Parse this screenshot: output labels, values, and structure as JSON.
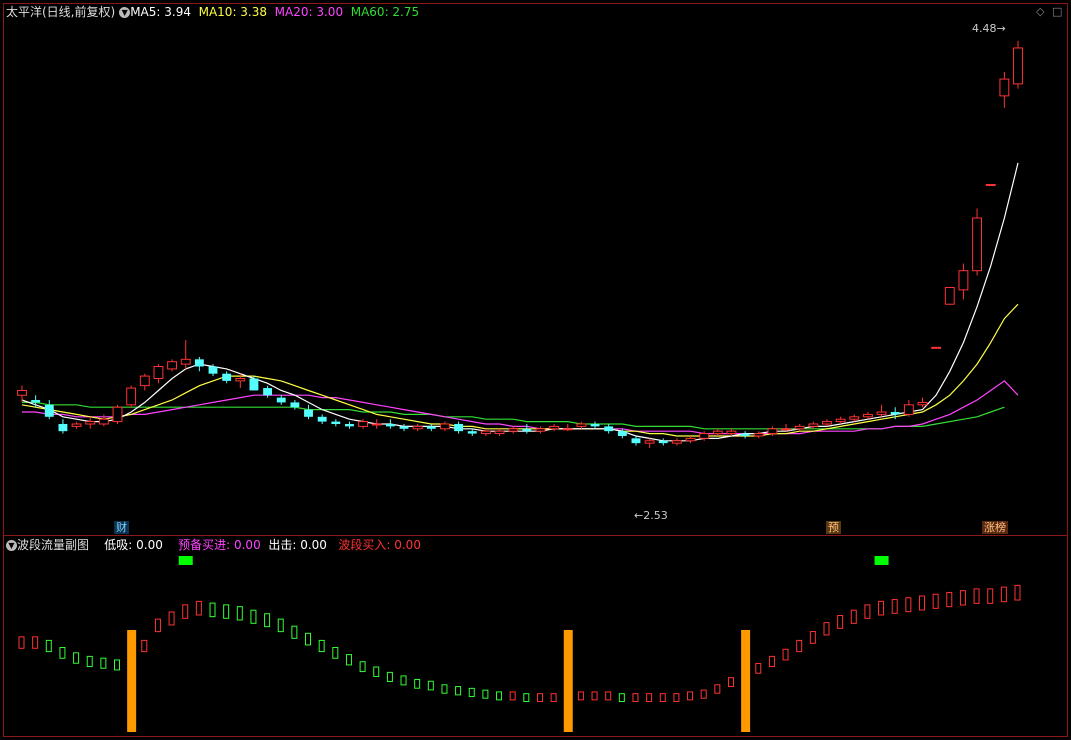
{
  "main_panel": {
    "title": "太平洋(日线,前复权)",
    "ma5_label": "MA5: 3.94",
    "ma10_label": "MA10: 3.38",
    "ma20_label": "MA20: 3.00",
    "ma60_label": "MA60: 2.75",
    "high_annotation": "4.48",
    "low_annotation": "2.53",
    "event_tags": [
      "财",
      "预",
      "涨榜"
    ],
    "colors": {
      "ma5": "#ffffff",
      "ma10": "#ffff44",
      "ma20": "#ff44ff",
      "ma60": "#33dd33",
      "up": "#ff3333",
      "down": "#55ffff"
    }
  },
  "sub_panel": {
    "title": "波段流量副图",
    "low_buy_label": "低吸: 0.00",
    "ready_buy_label": "预备买进: 0.00",
    "exit_label": "出击: 0.00",
    "wave_buy_label": "波段买入: 0.00",
    "colors": {
      "low_buy": "#ffffff",
      "ready_buy": "#ff44ff",
      "exit": "#ffffff",
      "wave_buy": "#ff3333",
      "bar": "#ff9900",
      "signal": "#00ff00"
    }
  },
  "icons": [
    "settings-circle-icon",
    "diamond-icon",
    "square-icon"
  ],
  "chart_data": {
    "type": "candlestick",
    "title": "太平洋(日线,前复权)",
    "ohlc": [
      [
        3.0,
        3.04,
        2.97,
        3.02
      ],
      [
        2.98,
        3.0,
        2.95,
        2.97
      ],
      [
        2.96,
        2.98,
        2.9,
        2.91
      ],
      [
        2.88,
        2.9,
        2.84,
        2.85
      ],
      [
        2.87,
        2.89,
        2.86,
        2.88
      ],
      [
        2.88,
        2.91,
        2.86,
        2.89
      ],
      [
        2.88,
        2.92,
        2.87,
        2.9
      ],
      [
        2.89,
        2.96,
        2.88,
        2.95
      ],
      [
        2.96,
        3.04,
        2.95,
        3.03
      ],
      [
        3.04,
        3.09,
        3.02,
        3.08
      ],
      [
        3.07,
        3.13,
        3.05,
        3.12
      ],
      [
        3.11,
        3.15,
        3.1,
        3.14
      ],
      [
        3.13,
        3.23,
        3.11,
        3.15
      ],
      [
        3.15,
        3.16,
        3.1,
        3.12
      ],
      [
        3.12,
        3.13,
        3.08,
        3.09
      ],
      [
        3.09,
        3.1,
        3.05,
        3.06
      ],
      [
        3.06,
        3.09,
        3.03,
        3.07
      ],
      [
        3.07,
        3.08,
        3.02,
        3.02
      ],
      [
        3.03,
        3.04,
        2.99,
        3.0
      ],
      [
        2.99,
        3.0,
        2.96,
        2.97
      ],
      [
        2.97,
        2.98,
        2.94,
        2.95
      ],
      [
        2.94,
        2.96,
        2.9,
        2.91
      ],
      [
        2.91,
        2.92,
        2.88,
        2.89
      ],
      [
        2.89,
        2.9,
        2.87,
        2.88
      ],
      [
        2.88,
        2.89,
        2.86,
        2.87
      ],
      [
        2.87,
        2.9,
        2.86,
        2.89
      ],
      [
        2.88,
        2.9,
        2.86,
        2.88
      ],
      [
        2.88,
        2.9,
        2.86,
        2.87
      ],
      [
        2.87,
        2.88,
        2.85,
        2.86
      ],
      [
        2.86,
        2.88,
        2.85,
        2.87
      ],
      [
        2.87,
        2.88,
        2.85,
        2.86
      ],
      [
        2.86,
        2.89,
        2.85,
        2.88
      ],
      [
        2.88,
        2.89,
        2.84,
        2.85
      ],
      [
        2.85,
        2.86,
        2.83,
        2.84
      ],
      [
        2.84,
        2.86,
        2.83,
        2.85
      ],
      [
        2.84,
        2.86,
        2.83,
        2.85
      ],
      [
        2.85,
        2.87,
        2.84,
        2.86
      ],
      [
        2.86,
        2.88,
        2.84,
        2.85
      ],
      [
        2.85,
        2.87,
        2.84,
        2.86
      ],
      [
        2.86,
        2.88,
        2.85,
        2.87
      ],
      [
        2.86,
        2.88,
        2.85,
        2.86
      ],
      [
        2.87,
        2.89,
        2.86,
        2.88
      ],
      [
        2.88,
        2.89,
        2.86,
        2.87
      ],
      [
        2.87,
        2.88,
        2.84,
        2.85
      ],
      [
        2.85,
        2.86,
        2.82,
        2.83
      ],
      [
        2.82,
        2.83,
        2.79,
        2.8
      ],
      [
        2.8,
        2.82,
        2.78,
        2.81
      ],
      [
        2.81,
        2.82,
        2.79,
        2.8
      ],
      [
        2.8,
        2.82,
        2.79,
        2.81
      ],
      [
        2.81,
        2.83,
        2.8,
        2.82
      ],
      [
        2.82,
        2.85,
        2.81,
        2.84
      ],
      [
        2.84,
        2.86,
        2.83,
        2.85
      ],
      [
        2.84,
        2.86,
        2.83,
        2.85
      ],
      [
        2.84,
        2.85,
        2.82,
        2.83
      ],
      [
        2.83,
        2.85,
        2.82,
        2.84
      ],
      [
        2.84,
        2.87,
        2.83,
        2.86
      ],
      [
        2.86,
        2.88,
        2.85,
        2.86
      ],
      [
        2.86,
        2.88,
        2.85,
        2.87
      ],
      [
        2.87,
        2.89,
        2.86,
        2.88
      ],
      [
        2.88,
        2.9,
        2.87,
        2.89
      ],
      [
        2.89,
        2.91,
        2.88,
        2.9
      ],
      [
        2.9,
        2.92,
        2.89,
        2.91
      ],
      [
        2.91,
        2.93,
        2.9,
        2.92
      ],
      [
        2.92,
        2.96,
        2.91,
        2.93
      ],
      [
        2.93,
        2.95,
        2.9,
        2.92
      ],
      [
        2.92,
        2.98,
        2.91,
        2.96
      ],
      [
        2.96,
        2.99,
        2.95,
        2.97
      ],
      [
        3.2,
        3.2,
        3.2,
        3.2
      ],
      [
        3.38,
        3.45,
        3.38,
        3.45
      ],
      [
        3.44,
        3.55,
        3.4,
        3.52
      ],
      [
        3.52,
        3.78,
        3.5,
        3.74
      ],
      [
        3.88,
        3.88,
        3.88,
        3.88
      ],
      [
        4.25,
        4.35,
        4.2,
        4.32
      ],
      [
        4.3,
        4.48,
        4.28,
        4.45
      ]
    ],
    "ma5": [
      2.98,
      2.96,
      2.94,
      2.91,
      2.9,
      2.89,
      2.89,
      2.9,
      2.93,
      2.97,
      3.02,
      3.07,
      3.11,
      3.13,
      3.12,
      3.11,
      3.09,
      3.07,
      3.05,
      3.02,
      3.0,
      2.97,
      2.94,
      2.92,
      2.9,
      2.89,
      2.88,
      2.88,
      2.87,
      2.87,
      2.87,
      2.87,
      2.86,
      2.86,
      2.85,
      2.85,
      2.85,
      2.85,
      2.85,
      2.86,
      2.86,
      2.86,
      2.86,
      2.86,
      2.85,
      2.83,
      2.82,
      2.81,
      2.81,
      2.81,
      2.82,
      2.82,
      2.83,
      2.84,
      2.84,
      2.85,
      2.85,
      2.86,
      2.87,
      2.87,
      2.88,
      2.89,
      2.9,
      2.91,
      2.92,
      2.93,
      2.94,
      3.0,
      3.1,
      3.22,
      3.37,
      3.54,
      3.74,
      3.97
    ],
    "ma10": [
      2.96,
      2.95,
      2.94,
      2.93,
      2.92,
      2.91,
      2.9,
      2.91,
      2.92,
      2.94,
      2.96,
      2.98,
      3.01,
      3.04,
      3.06,
      3.08,
      3.08,
      3.08,
      3.07,
      3.06,
      3.04,
      3.02,
      3.0,
      2.98,
      2.96,
      2.94,
      2.92,
      2.91,
      2.9,
      2.89,
      2.88,
      2.88,
      2.87,
      2.87,
      2.86,
      2.86,
      2.86,
      2.86,
      2.86,
      2.86,
      2.86,
      2.86,
      2.86,
      2.86,
      2.85,
      2.85,
      2.84,
      2.84,
      2.83,
      2.83,
      2.83,
      2.83,
      2.83,
      2.83,
      2.83,
      2.84,
      2.84,
      2.85,
      2.85,
      2.86,
      2.87,
      2.88,
      2.89,
      2.9,
      2.91,
      2.92,
      2.93,
      2.96,
      3.0,
      3.06,
      3.13,
      3.22,
      3.32,
      3.38
    ],
    "ma20": [
      2.93,
      2.93,
      2.92,
      2.92,
      2.91,
      2.91,
      2.91,
      2.91,
      2.92,
      2.92,
      2.93,
      2.94,
      2.95,
      2.96,
      2.97,
      2.98,
      2.99,
      3.0,
      3.0,
      3.0,
      3.0,
      3.0,
      2.99,
      2.99,
      2.98,
      2.97,
      2.96,
      2.95,
      2.94,
      2.93,
      2.92,
      2.91,
      2.9,
      2.89,
      2.88,
      2.88,
      2.87,
      2.87,
      2.86,
      2.86,
      2.86,
      2.86,
      2.86,
      2.86,
      2.86,
      2.85,
      2.85,
      2.85,
      2.85,
      2.85,
      2.84,
      2.84,
      2.84,
      2.84,
      2.84,
      2.84,
      2.84,
      2.84,
      2.85,
      2.85,
      2.85,
      2.85,
      2.86,
      2.86,
      2.87,
      2.87,
      2.88,
      2.9,
      2.92,
      2.95,
      2.98,
      3.02,
      3.06,
      3.0
    ],
    "ma60": [
      2.97,
      2.97,
      2.96,
      2.96,
      2.96,
      2.95,
      2.95,
      2.95,
      2.95,
      2.95,
      2.95,
      2.95,
      2.95,
      2.95,
      2.95,
      2.95,
      2.95,
      2.95,
      2.95,
      2.95,
      2.95,
      2.94,
      2.94,
      2.94,
      2.94,
      2.93,
      2.93,
      2.93,
      2.92,
      2.92,
      2.92,
      2.91,
      2.91,
      2.91,
      2.9,
      2.9,
      2.9,
      2.89,
      2.89,
      2.89,
      2.89,
      2.88,
      2.88,
      2.88,
      2.88,
      2.87,
      2.87,
      2.87,
      2.87,
      2.87,
      2.86,
      2.86,
      2.86,
      2.86,
      2.86,
      2.86,
      2.86,
      2.86,
      2.86,
      2.86,
      2.86,
      2.86,
      2.86,
      2.86,
      2.87,
      2.87,
      2.87,
      2.88,
      2.89,
      2.9,
      2.91,
      2.93,
      2.95,
      2.75
    ],
    "indicator": {
      "wave": [
        0.52,
        0.52,
        0.5,
        0.46,
        0.43,
        0.41,
        0.4,
        0.39,
        0.4,
        0.5,
        0.62,
        0.66,
        0.7,
        0.72,
        0.71,
        0.7,
        0.69,
        0.67,
        0.65,
        0.62,
        0.58,
        0.54,
        0.5,
        0.46,
        0.42,
        0.38,
        0.35,
        0.32,
        0.3,
        0.28,
        0.27,
        0.25,
        0.24,
        0.23,
        0.22,
        0.21,
        0.21,
        0.2,
        0.2,
        0.2,
        0.2,
        0.21,
        0.21,
        0.21,
        0.2,
        0.2,
        0.2,
        0.2,
        0.2,
        0.21,
        0.22,
        0.25,
        0.29,
        0.33,
        0.37,
        0.41,
        0.45,
        0.5,
        0.55,
        0.6,
        0.64,
        0.67,
        0.7,
        0.72,
        0.73,
        0.74,
        0.75,
        0.76,
        0.77,
        0.78,
        0.79,
        0.79,
        0.8,
        0.81
      ],
      "orange_bars_at": [
        8,
        40,
        53
      ],
      "green_signals_at": [
        12,
        63
      ]
    }
  }
}
